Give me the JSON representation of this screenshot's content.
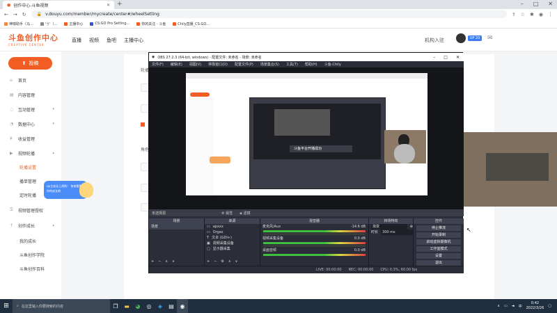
{
  "browser": {
    "tab_title": "创作中心-斗鱼视频",
    "url": "v.douyu.com/member/mycreate/center#/wheelSetting",
    "bookmarks": [
      "神嗅助手（马...",
      "'う'（...",
      "主播中心",
      "CS:GO Pro Setting...",
      "你的关注 - 斗鱼",
      "Chily直播_CS:GO..."
    ]
  },
  "site": {
    "logo_main": "斗鱼创作中心",
    "logo_sub": "CREATIVE CENTER",
    "nav": [
      "直播",
      "视频",
      "鱼吧",
      "主播中心"
    ],
    "login": "机构入驻",
    "level_badge": "UP 20"
  },
  "sidebar": {
    "publish": "投稿",
    "items": [
      {
        "label": "首页",
        "type": "top"
      },
      {
        "label": "内容管理",
        "type": "top"
      },
      {
        "label": "互动管理",
        "type": "top",
        "chev": true
      },
      {
        "label": "数据中心",
        "type": "top",
        "chev": true
      },
      {
        "label": "收益管理",
        "type": "top"
      },
      {
        "label": "视频轮播",
        "type": "top",
        "chev": true
      },
      {
        "label": "轮播设置",
        "type": "sub",
        "active": true
      },
      {
        "label": "播单管理",
        "type": "sub"
      },
      {
        "label": "定时轮播",
        "type": "sub"
      },
      {
        "label": "视频管理授权",
        "type": "top"
      },
      {
        "label": "创作成长",
        "type": "top",
        "chev": true
      },
      {
        "label": "我的成长",
        "type": "sub"
      },
      {
        "label": "斗鱼创作学院",
        "type": "sub"
      },
      {
        "label": "斗鱼创作百科",
        "type": "sub"
      }
    ],
    "promo": "up主成长上线啦！ 快来看看你的成长吧"
  },
  "main": {
    "heading": "轮播",
    "label2": "角色"
  },
  "obs": {
    "title": "OBS 27.2.3 (64-bit, windows) - 配置文件: 未命名 - 场景: 未命名",
    "menu": [
      "文件(F)",
      "编辑(E)",
      "视图(V)",
      "停靠窗口(D)",
      "配置文件(P)",
      "场景集合(S)",
      "工具(T)",
      "帮助(H)",
      "斗鱼-Chily"
    ],
    "scene_bar": "未选择源",
    "scene_props": "属性",
    "scene_filter": "滤镜",
    "panels": {
      "scenes": {
        "header": "场景",
        "items": [
          "场景"
        ]
      },
      "sources": {
        "header": "来源",
        "items": [
          "apxxx",
          "Orgas",
          "文本 (GDI+)",
          "视频采集设备",
          "显示器采集"
        ]
      },
      "mixer": {
        "header": "混音器",
        "channels": [
          {
            "name": "麦克风/Aux",
            "db": "-14.6 dB"
          },
          {
            "name": "视频采集设备",
            "db": "0.0 dB"
          },
          {
            "name": "桌面音频",
            "db": "0.0 dB"
          }
        ]
      },
      "transitions": {
        "header": "转场特效",
        "mode": "渐变",
        "duration_label": "时长",
        "duration": "300 ms"
      },
      "controls": {
        "header": "控件",
        "buttons": [
          "停止推流",
          "开始录制",
          "启动虚拟摄像机",
          "工作室模式",
          "设置",
          "退出"
        ]
      }
    },
    "status": {
      "live": "LIVE: 00:00:00",
      "rec": "REC: 00:00:00",
      "cpu": "CPU: 0.3%, 60.00 fps"
    },
    "inner_toast": "斗鱼平台开播成功"
  },
  "taskbar": {
    "search_placeholder": "在这里输入你要搜索的内容",
    "time": "0:42",
    "date": "2022/3/26",
    "ime": "中"
  }
}
